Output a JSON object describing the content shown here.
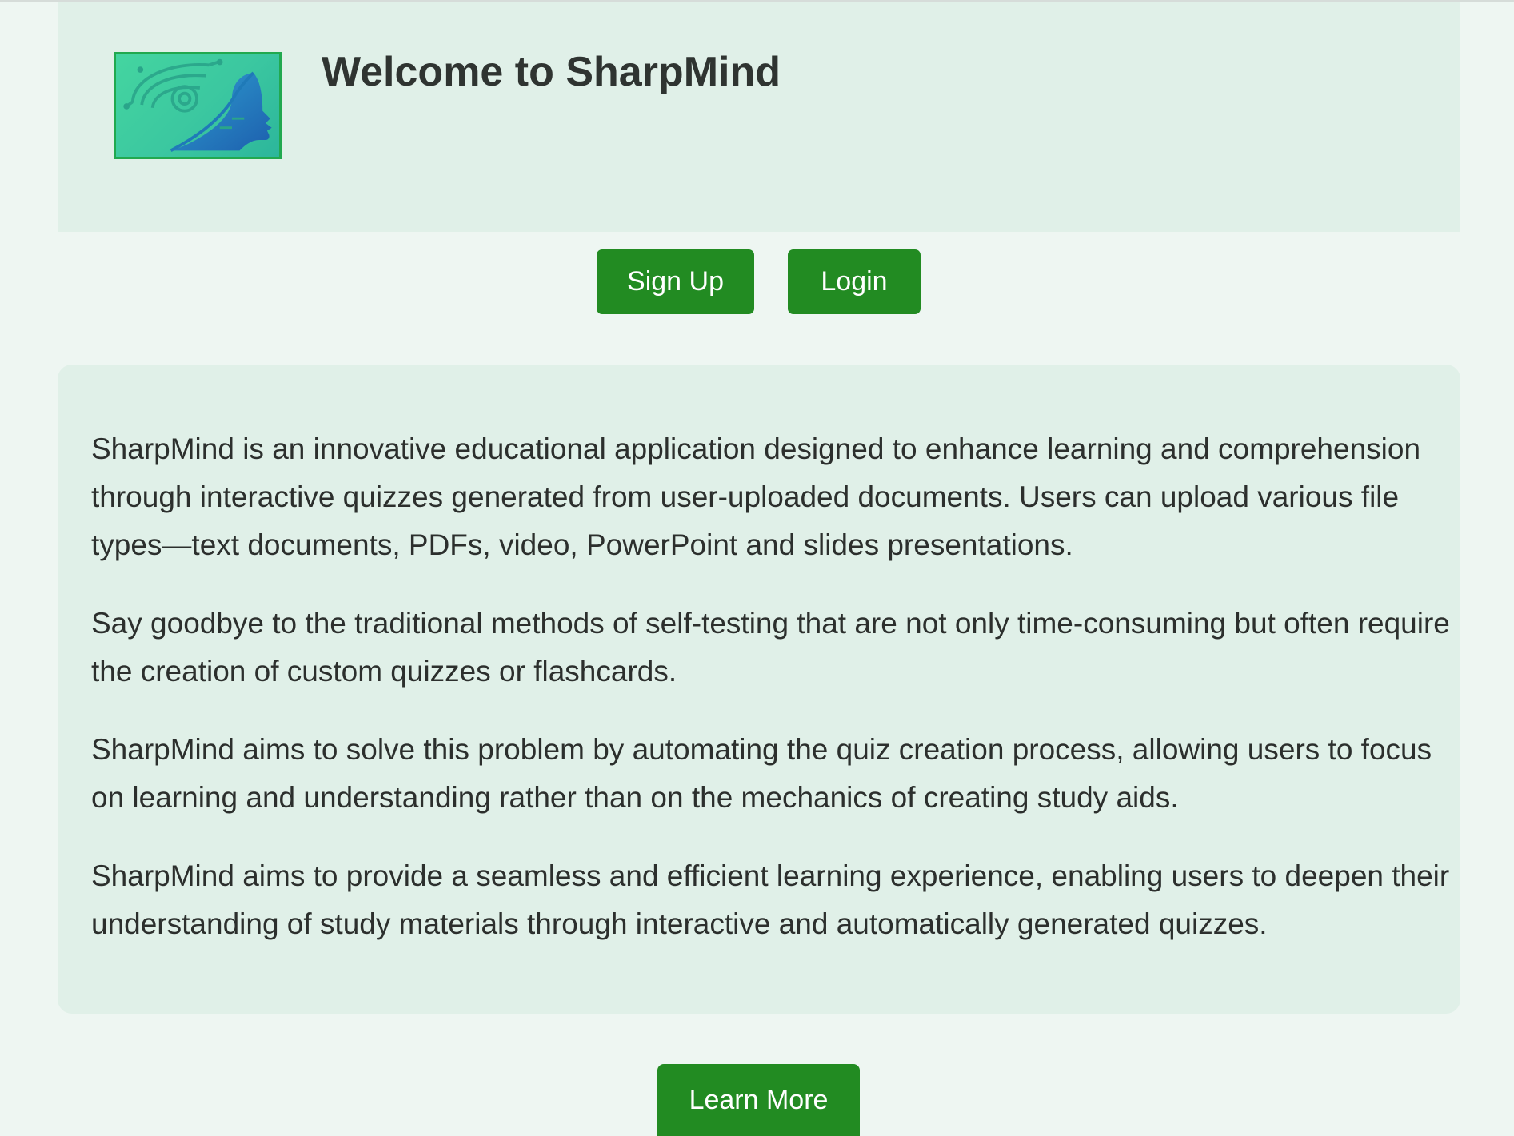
{
  "header": {
    "title": "Welcome to SharpMind",
    "logo_icon": "brain-circuit-head-icon"
  },
  "auth": {
    "signup_label": "Sign Up",
    "login_label": "Login"
  },
  "intro": {
    "paragraphs": [
      "SharpMind is an innovative educational application designed to enhance learning and comprehension through interactive quizzes generated from user-uploaded documents. Users can upload various file types—text documents, PDFs, video, PowerPoint and slides presentations.",
      "Say goodbye to the traditional methods of self-testing that are not only time-consuming but often require the creation of custom quizzes or flashcards.",
      "SharpMind aims to solve this problem by automating the quiz creation process, allowing users to focus on learning and understanding rather than on the mechanics of creating study aids.",
      "SharpMind aims to provide a seamless and efficient learning experience, enabling users to deepen their understanding of study materials through interactive and automatically generated quizzes."
    ]
  },
  "footer": {
    "learn_more_label": "Learn More"
  },
  "colors": {
    "page_background": "#eef6f2",
    "panel_background": "#e0f0e8",
    "button": "#228b22",
    "logo_border": "#21a94f",
    "text": "#2c2f2d"
  }
}
